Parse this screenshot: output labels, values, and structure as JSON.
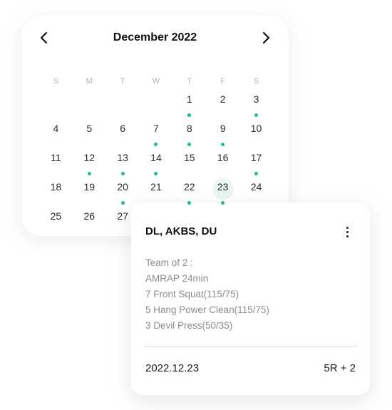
{
  "calendar": {
    "month_title": "December 2022",
    "weekdays": [
      "S",
      "M",
      "T",
      "W",
      "T",
      "F",
      "S"
    ],
    "days": [
      {
        "label": "",
        "dot": false
      },
      {
        "label": "",
        "dot": false
      },
      {
        "label": "",
        "dot": false
      },
      {
        "label": "",
        "dot": false
      },
      {
        "label": "1",
        "dot": true
      },
      {
        "label": "2",
        "dot": false
      },
      {
        "label": "3",
        "dot": true
      },
      {
        "label": "4",
        "dot": false
      },
      {
        "label": "5",
        "dot": false
      },
      {
        "label": "6",
        "dot": false
      },
      {
        "label": "7",
        "dot": true
      },
      {
        "label": "8",
        "dot": true
      },
      {
        "label": "9",
        "dot": true
      },
      {
        "label": "10",
        "dot": false
      },
      {
        "label": "11",
        "dot": false
      },
      {
        "label": "12",
        "dot": true
      },
      {
        "label": "13",
        "dot": true
      },
      {
        "label": "14",
        "dot": true
      },
      {
        "label": "15",
        "dot": false
      },
      {
        "label": "16",
        "dot": false
      },
      {
        "label": "17",
        "dot": true
      },
      {
        "label": "18",
        "dot": false
      },
      {
        "label": "19",
        "dot": false
      },
      {
        "label": "20",
        "dot": true
      },
      {
        "label": "21",
        "dot": false
      },
      {
        "label": "22",
        "dot": true
      },
      {
        "label": "23",
        "dot": true,
        "selected": true
      },
      {
        "label": "24",
        "dot": false
      },
      {
        "label": "25",
        "dot": false
      },
      {
        "label": "26",
        "dot": false
      },
      {
        "label": "27",
        "dot": false
      }
    ],
    "icons": {
      "prev": "chevron-left-icon",
      "next": "chevron-right-icon"
    },
    "colors": {
      "dot": "#1ec07d",
      "selected_bg": "#e8f7ef"
    }
  },
  "card": {
    "title": "DL, AKBS, DU",
    "more_icon": "more-vertical-icon",
    "lines": [
      "Team of 2 :",
      "AMRAP 24min",
      "7 Front Squat(115/75)",
      "5 Hang Power Clean(115/75)",
      "3 Devil Press(50/35)"
    ],
    "date": "2022.12.23",
    "score": "5R + 2"
  }
}
